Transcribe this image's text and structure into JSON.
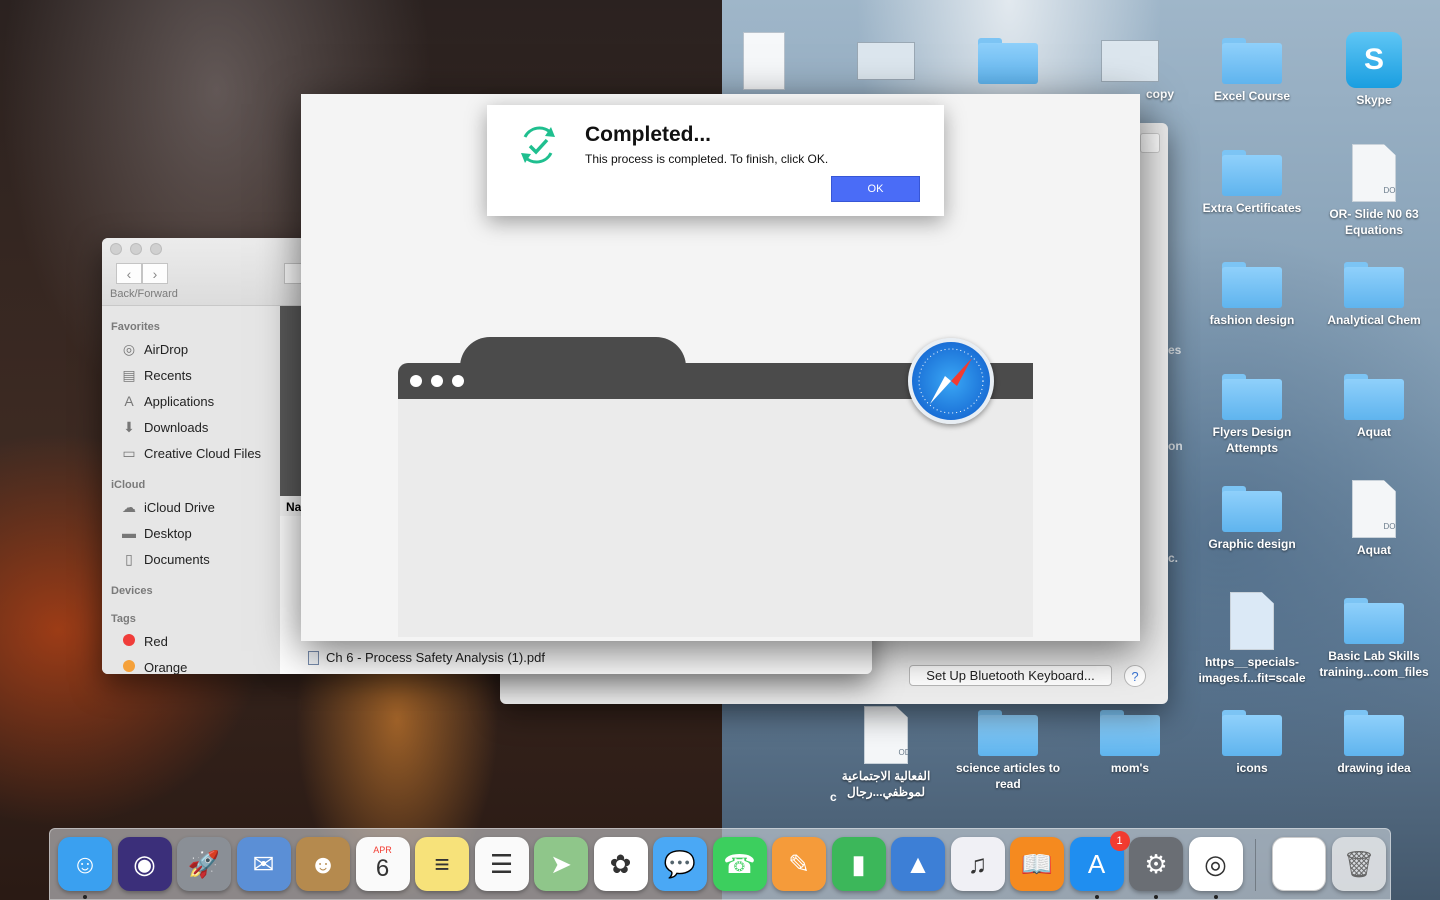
{
  "desktop": {
    "icons_top": [
      {
        "label": "",
        "kind": "doc-thumb"
      },
      {
        "label": "",
        "kind": "screen-thumb"
      },
      {
        "label": "",
        "kind": "folder"
      },
      {
        "label": "copy",
        "kind": "image-thumb"
      },
      {
        "label": "Excel Course",
        "kind": "folder"
      },
      {
        "label": "Skype",
        "kind": "skype"
      }
    ],
    "icons_right": [
      {
        "label": "Extra Certificates",
        "kind": "folder"
      },
      {
        "label": "OR- Slide N0 63 Equations",
        "kind": "docx",
        "tag": "DOCX"
      },
      {
        "label": "fashion design",
        "kind": "folder"
      },
      {
        "label": "Analytical Chem",
        "kind": "folder"
      },
      {
        "label": "Flyers Design Attempts",
        "kind": "folder"
      },
      {
        "label": "Aquat",
        "kind": "folder"
      },
      {
        "label": "Graphic design",
        "kind": "folder"
      },
      {
        "label": "Aquat",
        "kind": "docx",
        "tag": "DOCX"
      },
      {
        "label": "https__specials-images.f...fit=scale",
        "kind": "doc"
      },
      {
        "label": "Basic Lab Skills training...com_files",
        "kind": "folder"
      }
    ],
    "icons_bottom": [
      {
        "label": "الفعالية الاجتماعية لموظفي...رجال",
        "kind": "odt",
        "tag": "ODT"
      },
      {
        "label": "science articles to read",
        "kind": "folder"
      },
      {
        "label": "mom's",
        "kind": "folder"
      },
      {
        "label": "icons",
        "kind": "folder"
      },
      {
        "label": "drawing idea",
        "kind": "folder"
      }
    ],
    "partial_labels": [
      "es",
      "on",
      "c.",
      "c"
    ]
  },
  "finder": {
    "nav_label": "Back/Forward",
    "sidebar": {
      "favorites_head": "Favorites",
      "favorites": [
        {
          "label": "AirDrop",
          "icon": "airdrop-icon"
        },
        {
          "label": "Recents",
          "icon": "recents-icon"
        },
        {
          "label": "Applications",
          "icon": "applications-icon"
        },
        {
          "label": "Downloads",
          "icon": "downloads-icon"
        },
        {
          "label": "Creative Cloud Files",
          "icon": "folder-icon"
        }
      ],
      "icloud_head": "iCloud",
      "icloud": [
        {
          "label": "iCloud Drive",
          "icon": "cloud-icon"
        },
        {
          "label": "Desktop",
          "icon": "desktop-icon"
        },
        {
          "label": "Documents",
          "icon": "documents-icon"
        }
      ],
      "devices_head": "Devices",
      "tags_head": "Tags",
      "tags": [
        {
          "label": "Red",
          "color": "#f03d3a"
        },
        {
          "label": "Orange",
          "color": "#f5a13a"
        }
      ]
    },
    "column_header": "Na",
    "files": [
      "Ch 6 - Process Safety Analysis (1).pdf"
    ]
  },
  "prefs": {
    "bt_button": "Set Up Bluetooth Keyboard...",
    "help": "?"
  },
  "dialog": {
    "title": "Completed...",
    "message": "This process is completed. To finish, click OK.",
    "ok": "OK",
    "accent": "#4a6cf7",
    "icon_color": "#1fbf8f"
  },
  "dock": {
    "apps": [
      {
        "name": "finder-icon",
        "color": "#3aa0f0",
        "glyph": "☺",
        "running": true
      },
      {
        "name": "siri-icon",
        "color": "#3b2f7a",
        "glyph": "◉",
        "running": false
      },
      {
        "name": "launchpad-icon",
        "color": "#8a8f96",
        "glyph": "🚀",
        "running": false
      },
      {
        "name": "mail-icon",
        "color": "#5b8fd6",
        "glyph": "✉",
        "running": false
      },
      {
        "name": "contacts-icon",
        "color": "#b58a4e",
        "glyph": "☻",
        "running": false
      },
      {
        "name": "calendar-icon",
        "color": "#fafafa",
        "glyph": "6",
        "running": false,
        "month": "APR"
      },
      {
        "name": "notes-icon",
        "color": "#f7e27a",
        "glyph": "≡",
        "running": false
      },
      {
        "name": "reminders-icon",
        "color": "#fafafa",
        "glyph": "☰",
        "running": false
      },
      {
        "name": "maps-icon",
        "color": "#8fc68a",
        "glyph": "➤",
        "running": false
      },
      {
        "name": "photos-icon",
        "color": "#ffffff",
        "glyph": "✿",
        "running": false
      },
      {
        "name": "messages-icon",
        "color": "#4aa8f5",
        "glyph": "💬",
        "running": false
      },
      {
        "name": "facetime-icon",
        "color": "#3ccf5e",
        "glyph": "☎",
        "running": false
      },
      {
        "name": "pages-icon",
        "color": "#f59b3a",
        "glyph": "✎",
        "running": false
      },
      {
        "name": "numbers-icon",
        "color": "#3cb75a",
        "glyph": "▮",
        "running": false
      },
      {
        "name": "keynote-icon",
        "color": "#3d7fd6",
        "glyph": "▲",
        "running": false
      },
      {
        "name": "itunes-icon",
        "color": "#f0f0f5",
        "glyph": "♫",
        "running": false
      },
      {
        "name": "ibooks-icon",
        "color": "#f58a1f",
        "glyph": "📖",
        "running": false
      },
      {
        "name": "app-store-icon",
        "color": "#1f8ef0",
        "glyph": "A",
        "running": true,
        "badge": "1"
      },
      {
        "name": "system-preferences-icon",
        "color": "#6a6e74",
        "glyph": "⚙",
        "running": true
      },
      {
        "name": "chrome-icon",
        "color": "#ffffff",
        "glyph": "◎",
        "running": true
      }
    ],
    "stack_icon": "document-stack-icon",
    "trash_icon": "trash-icon"
  }
}
